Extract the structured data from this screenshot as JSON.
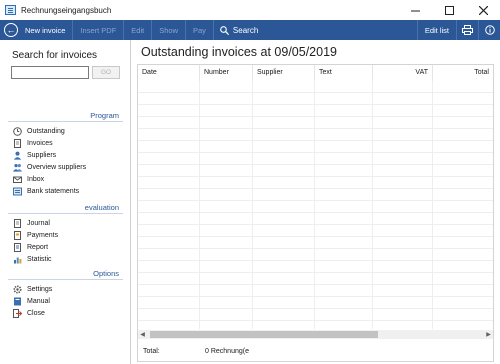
{
  "window": {
    "title": "Rechnungseingangsbuch"
  },
  "toolbar": {
    "new_invoice": "New invoice",
    "insert_pdf": "Insert PDF",
    "edit": "Edit",
    "show": "Show",
    "pay": "Pay",
    "search": "Search",
    "edit_list": "Edit list"
  },
  "sidebar": {
    "search_title": "Search for invoices",
    "search_value": "",
    "go_label": "GO",
    "sections": {
      "program": "Program",
      "evaluation": "evaluation",
      "options": "Options"
    },
    "program_items": [
      "Outstanding",
      "Invoices",
      "Suppliers",
      "Overview suppliers",
      "Inbox",
      "Bank statements"
    ],
    "evaluation_items": [
      "Journal",
      "Payments",
      "Report",
      "Statistic"
    ],
    "options_items": [
      "Settings",
      "Manual",
      "Close"
    ]
  },
  "main": {
    "title": "Outstanding invoices at 09/05/2019",
    "columns": [
      "Date",
      "Number",
      "Supplier",
      "Text",
      "VAT",
      "Total"
    ],
    "footer": {
      "total_label": "Total:",
      "total_count": "0 Rechnung(e"
    }
  },
  "colors": {
    "toolbar": "#2b5797",
    "accent": "#2b5797"
  }
}
